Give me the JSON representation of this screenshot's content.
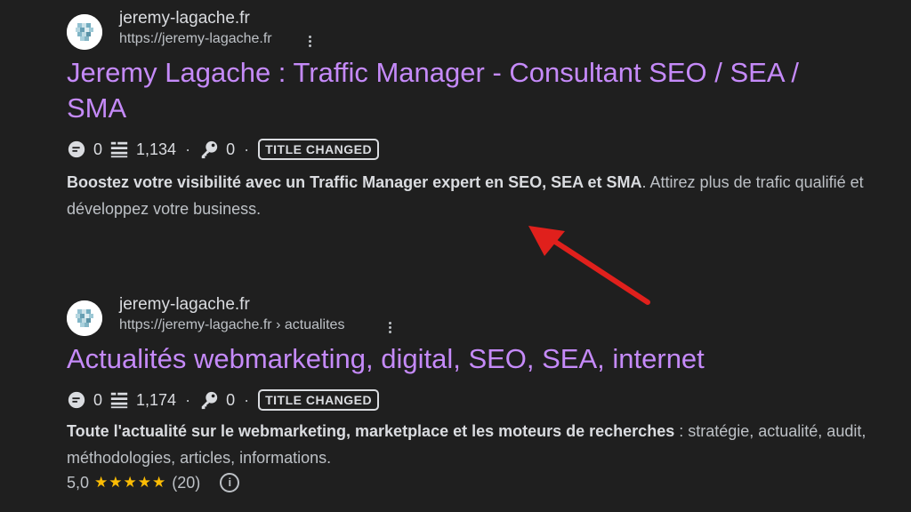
{
  "results": [
    {
      "site_name": "jeremy-lagache.fr",
      "site_url": "https://jeremy-lagache.fr",
      "title_line1": "Jeremy Lagache : Traffic Manager - Consultant SEO / SEA /",
      "title_line2": "SMA",
      "metrics": {
        "comments": "0",
        "words": "1,134",
        "dot1": "·",
        "keys": "0",
        "dot2": "·",
        "badge": "TITLE CHANGED"
      },
      "snippet_bold": "Boostez votre visibilité avec un Traffic Manager expert en SEO, SEA et SMA",
      "snippet_rest": ". Attirez plus de trafic qualifié et développez votre business."
    },
    {
      "site_name": "jeremy-lagache.fr",
      "site_url": "https://jeremy-lagache.fr › actualites",
      "title_line1": "Actualités webmarketing, digital, SEO, SEA, internet",
      "metrics": {
        "comments": "0",
        "words": "1,174",
        "dot1": "·",
        "keys": "0",
        "dot2": "·",
        "badge": "TITLE CHANGED"
      },
      "snippet_bold": "Toute l'actualité sur le webmarketing, marketplace et les moteurs de recherches",
      "snippet_rest": " : stratégie, actualité, audit, méthodologies, articles, informations.",
      "rating": {
        "score": "5,0",
        "stars": "★★★★★",
        "count": "(20)",
        "info_glyph": "i"
      }
    }
  ],
  "colors": {
    "background": "#1f1f1f",
    "title_link": "#c58af9",
    "text": "#bdc1c6",
    "star": "#fbbc04",
    "arrow": "#e0201c"
  },
  "icons": [
    "more-vert-icon",
    "comment-icon",
    "word-count-icon",
    "key-icon",
    "info-icon",
    "red-arrow-annotation"
  ]
}
